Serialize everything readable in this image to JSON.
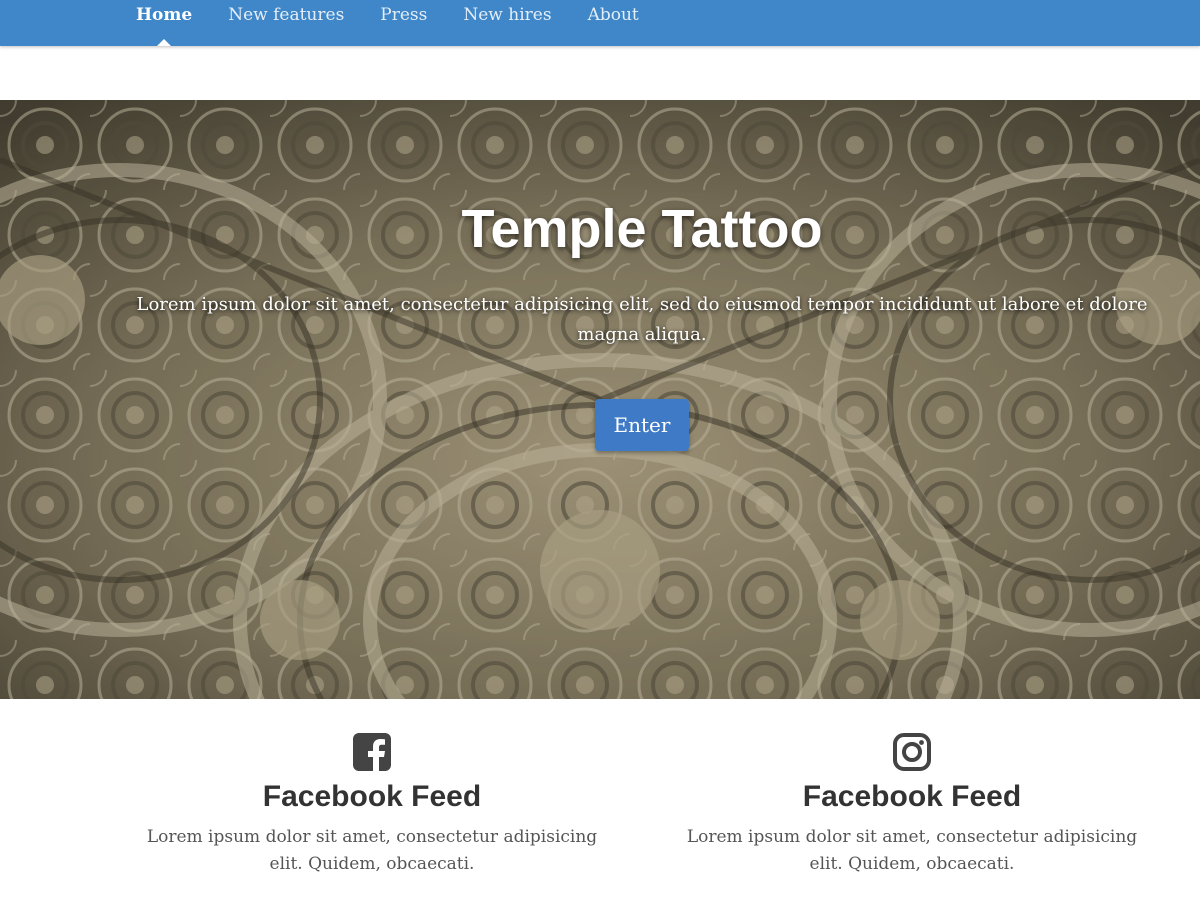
{
  "nav": {
    "items": [
      {
        "label": "Home",
        "active": true
      },
      {
        "label": "New features",
        "active": false
      },
      {
        "label": "Press",
        "active": false
      },
      {
        "label": "New hires",
        "active": false
      },
      {
        "label": "About",
        "active": false
      }
    ]
  },
  "hero": {
    "title": "Temple Tattoo",
    "text": "Lorem ipsum dolor sit amet, consectetur adipisicing elit, sed do eiusmod tempor incididunt ut labore et dolore magna aliqua.",
    "button_label": "Enter"
  },
  "feeds": [
    {
      "icon": "facebook-icon",
      "title": "Facebook Feed",
      "text": "Lorem ipsum dolor sit amet, consectetur adipisicing elit. Quidem, obcaecati."
    },
    {
      "icon": "instagram-icon",
      "title": "Facebook Feed",
      "text": "Lorem ipsum dolor sit amet, consectetur adipisicing elit. Quidem, obcaecati."
    }
  ],
  "colors": {
    "navbar": "#3f87c8",
    "button": "#3f7ac6",
    "icon": "#444444"
  }
}
